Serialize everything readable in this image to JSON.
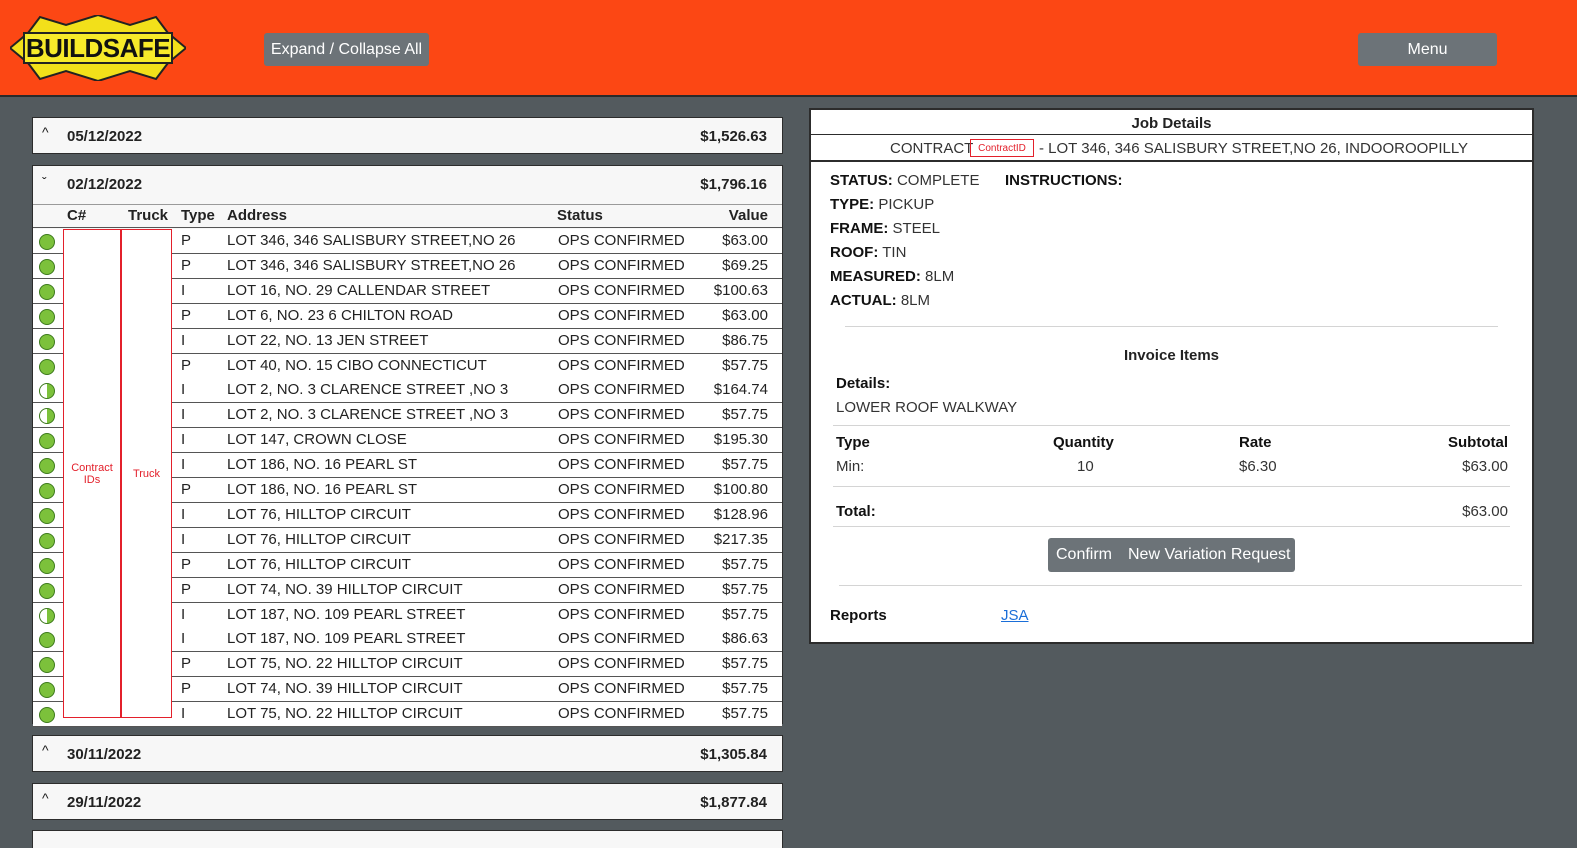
{
  "header": {
    "logo_text": "BUILDSAFE",
    "expand_label": "Expand / Collapse All",
    "menu_label": "Menu"
  },
  "groups": [
    {
      "date": "05/12/2022",
      "total": "$1,526.63"
    },
    {
      "date": "02/12/2022",
      "total": "$1,796.16"
    },
    {
      "date": "30/11/2022",
      "total": "$1,305.84"
    },
    {
      "date": "29/11/2022",
      "total": "$1,877.84"
    }
  ],
  "table": {
    "headers": {
      "cnum": "C#",
      "truck": "Truck",
      "type": "Type",
      "address": "Address",
      "status": "Status",
      "value": "Value"
    },
    "contract_ids_label": "Contract IDs",
    "truck_label": "Truck",
    "rows": [
      {
        "state": "full",
        "type": "P",
        "address": "LOT 346, 346 SALISBURY STREET,NO 26",
        "status": "OPS CONFIRMED",
        "value": "$63.00"
      },
      {
        "state": "full",
        "type": "P",
        "address": "LOT 346, 346 SALISBURY STREET,NO 26",
        "status": "OPS CONFIRMED",
        "value": "$69.25"
      },
      {
        "state": "full",
        "type": "I",
        "address": "LOT 16, NO. 29 CALLENDAR STREET",
        "status": "OPS CONFIRMED",
        "value": "$100.63"
      },
      {
        "state": "full",
        "type": "P",
        "address": "LOT 6, NO. 23 6 CHILTON ROAD",
        "status": "OPS CONFIRMED",
        "value": "$63.00"
      },
      {
        "state": "full",
        "type": "I",
        "address": "LOT 22, NO. 13 JEN STREET",
        "status": "OPS CONFIRMED",
        "value": "$86.75"
      },
      {
        "state": "full",
        "type": "P",
        "address": "LOT 40, NO. 15 CIBO CONNECTICUT",
        "status": "OPS CONFIRMED",
        "value": "$57.75"
      },
      {
        "state": "half",
        "type": "I",
        "address": "LOT 2, NO. 3 CLARENCE STREET ,NO 3",
        "status": "OPS CONFIRMED",
        "value": "$164.74"
      },
      {
        "state": "half",
        "type": "I",
        "address": "LOT 2, NO. 3 CLARENCE STREET ,NO 3",
        "status": "OPS CONFIRMED",
        "value": "$57.75"
      },
      {
        "state": "full",
        "type": "I",
        "address": "LOT 147, CROWN CLOSE",
        "status": "OPS CONFIRMED",
        "value": "$195.30"
      },
      {
        "state": "full",
        "type": "I",
        "address": "LOT 186, NO. 16 PEARL ST",
        "status": "OPS CONFIRMED",
        "value": "$57.75"
      },
      {
        "state": "full",
        "type": "P",
        "address": "LOT 186, NO. 16 PEARL ST",
        "status": "OPS CONFIRMED",
        "value": "$100.80"
      },
      {
        "state": "full",
        "type": "I",
        "address": "LOT 76, HILLTOP CIRCUIT",
        "status": "OPS CONFIRMED",
        "value": "$128.96"
      },
      {
        "state": "full",
        "type": "I",
        "address": "LOT 76, HILLTOP CIRCUIT",
        "status": "OPS CONFIRMED",
        "value": "$217.35"
      },
      {
        "state": "full",
        "type": "P",
        "address": "LOT 76, HILLTOP CIRCUIT",
        "status": "OPS CONFIRMED",
        "value": "$57.75"
      },
      {
        "state": "full",
        "type": "P",
        "address": "LOT 74, NO. 39 HILLTOP CIRCUIT",
        "status": "OPS CONFIRMED",
        "value": "$57.75"
      },
      {
        "state": "half",
        "type": "I",
        "address": "LOT 187, NO. 109 PEARL STREET",
        "status": "OPS CONFIRMED",
        "value": "$57.75"
      },
      {
        "state": "full",
        "type": "I",
        "address": "LOT 187, NO. 109 PEARL STREET",
        "status": "OPS CONFIRMED",
        "value": "$86.63"
      },
      {
        "state": "full",
        "type": "P",
        "address": "LOT 75, NO. 22 HILLTOP CIRCUIT",
        "status": "OPS CONFIRMED",
        "value": "$57.75"
      },
      {
        "state": "full",
        "type": "P",
        "address": "LOT 74, NO. 39 HILLTOP CIRCUIT",
        "status": "OPS CONFIRMED",
        "value": "$57.75"
      },
      {
        "state": "full",
        "type": "I",
        "address": "LOT 75, NO. 22 HILLTOP CIRCUIT",
        "status": "OPS CONFIRMED",
        "value": "$57.75"
      }
    ]
  },
  "job": {
    "title": "Job Details",
    "contract_label": "CONTRACT",
    "contract_id": "ContractID",
    "contract_rest": "- LOT 346, 346 SALISBURY STREET,NO 26, INDOOROOPILLY",
    "status_label": "STATUS:",
    "status": "COMPLETE",
    "instructions_label": "INSTRUCTIONS:",
    "type_label": "TYPE:",
    "type": "PICKUP",
    "frame_label": "FRAME:",
    "frame": "STEEL",
    "roof_label": "ROOF:",
    "roof": "TIN",
    "measured_label": "MEASURED:",
    "measured": "8LM",
    "actual_label": "ACTUAL:",
    "actual": "8LM",
    "invoice_title": "Invoice Items",
    "details_label": "Details:",
    "details": "LOWER ROOF WALKWAY",
    "col_type": "Type",
    "col_qty": "Quantity",
    "col_rate": "Rate",
    "col_sub": "Subtotal",
    "item_type": "Min:",
    "item_qty": "10",
    "item_rate": "$6.30",
    "item_sub": "$63.00",
    "total_label": "Total:",
    "total": "$63.00",
    "confirm_label": "Confirm",
    "variation_label": "New Variation Request",
    "reports_label": "Reports",
    "jsa_label": "JSA"
  },
  "colors": {
    "topbar": "#fc4714",
    "page_bg": "#535a5e",
    "dot": "#7cc13b",
    "id_red": "#e3202b",
    "link": "#1a6ed8"
  }
}
